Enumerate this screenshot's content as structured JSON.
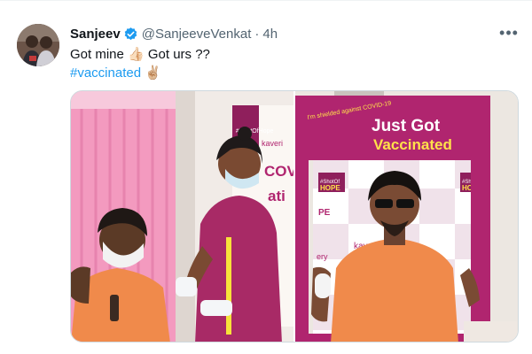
{
  "tweet": {
    "display_name": "Sanjeev",
    "handle": "@SanjeeveVenkat",
    "separator": "·",
    "time": "4h",
    "more_label": "•••",
    "text_line1": "Got mine 👍🏻 Got urs ??",
    "hashtag": "#vaccinated ✌🏼"
  },
  "media": {
    "left_photo": {
      "banner_hashtag": "#ShotOfHope",
      "banner_word": "kaveri",
      "banner_side_text": "COV",
      "banner_side_text2": "ati"
    },
    "right_photo": {
      "sign_small_text": "I'm shielded against COVID-19",
      "sign_title_line1": "Just Got",
      "sign_title_line2": "Vaccinated",
      "backdrop_hashtag1": "#ShotOf",
      "backdrop_hashtag2": "HOPE",
      "backdrop_hashtag3": "#Shot",
      "backdrop_hashtag4": "HOP",
      "backdrop_brand": "kaveri",
      "backdrop_brand2": "ery",
      "backdrop_fragment": "PE"
    }
  },
  "colors": {
    "accent": "#1d9bf0",
    "secondary_text": "#536471",
    "sign_magenta": "#b0256f",
    "sign_yellow": "#ffe14a",
    "shirt_orange": "#f08a4b"
  }
}
